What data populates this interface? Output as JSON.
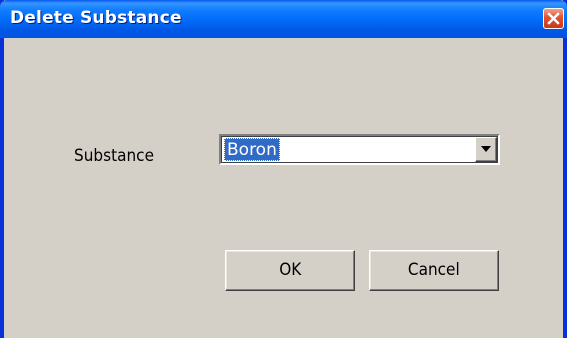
{
  "window": {
    "title": "Delete Substance",
    "close_icon": "close-icon"
  },
  "form": {
    "substance_label": "Substance",
    "substance_value": "Boron",
    "dropdown_icon": "chevron-down-icon"
  },
  "buttons": {
    "ok_label": "OK",
    "cancel_label": "Cancel"
  },
  "colors": {
    "titlebar": "#0054e3",
    "dialog_background": "#d4d0c8",
    "selection": "#316ac5",
    "close_button": "#e2512c"
  }
}
